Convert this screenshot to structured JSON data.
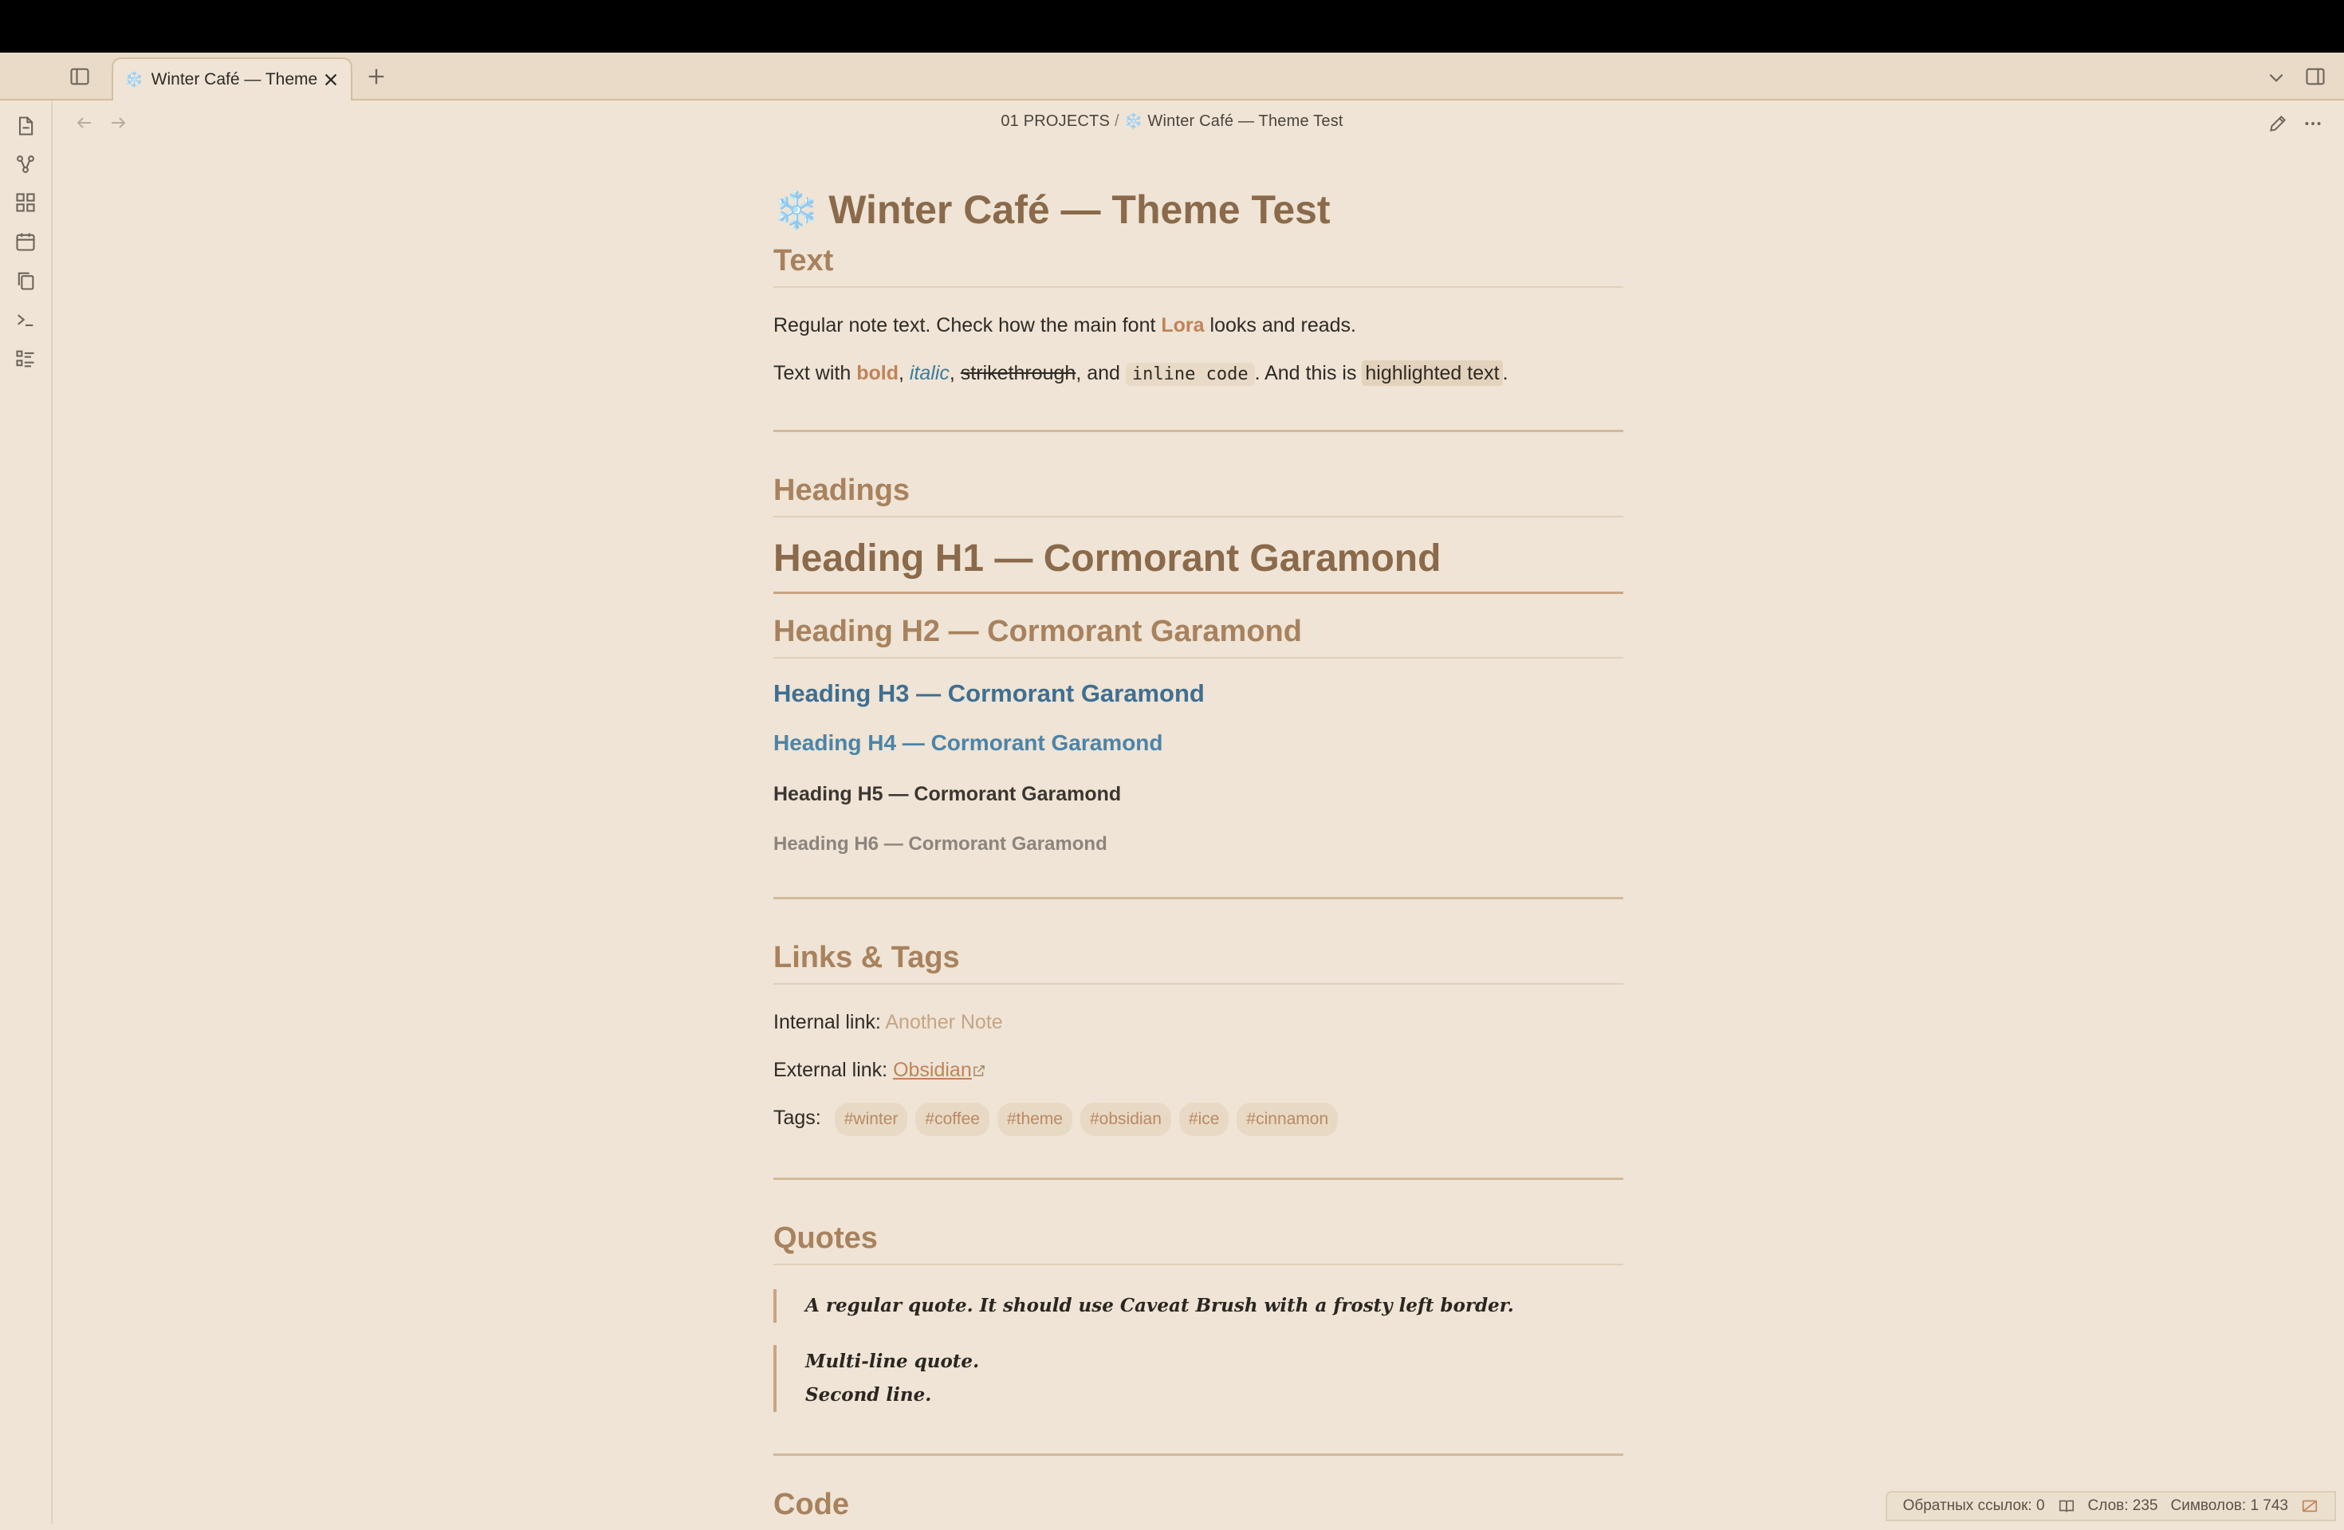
{
  "tab": {
    "title": "Winter Café — Theme ...",
    "emoji": "❄️"
  },
  "breadcrumb": {
    "folder": "01 PROJECTS",
    "separator": "/",
    "emoji": "❄️",
    "file": "Winter Café — Theme Test"
  },
  "note": {
    "title_emoji": "❄️",
    "title": "Winter Café — Theme Test",
    "text": {
      "heading": "Text",
      "p1_before": "Regular note text. Check how the main font ",
      "p1_font": "Lora",
      "p1_after": " looks and reads.",
      "p2_start": "Text with ",
      "bold": "bold",
      "comma1": ", ",
      "italic": "italic",
      "comma2": ", ",
      "strike": "strikethrough",
      "and": ", and ",
      "code": "inline code",
      "middle": ". And this is ",
      "highlight": "highlighted text",
      "end": "."
    },
    "headings": {
      "heading": "Headings",
      "h1": "Heading H1 — Cormorant Garamond",
      "h2": "Heading H2 — Cormorant Garamond",
      "h3": "Heading H3 — Cormorant Garamond",
      "h4": "Heading H4 — Cormorant Garamond",
      "h5": "Heading H5 — Cormorant Garamond",
      "h6": "Heading H6 — Cormorant Garamond"
    },
    "links": {
      "heading": "Links & Tags",
      "internal_label": "Internal link: ",
      "internal_link": "Another Note",
      "external_label": "External link: ",
      "external_link": "Obsidian",
      "tags_label": "Tags:",
      "tags": [
        "#winter",
        "#coffee",
        "#theme",
        "#obsidian",
        "#ice",
        "#cinnamon"
      ]
    },
    "quotes": {
      "heading": "Quotes",
      "q1": "A regular quote. It should use Caveat Brush with a frosty left border.",
      "q2_line1": "Multi-line quote.",
      "q2_line2": "Second line."
    },
    "code": {
      "heading": "Code"
    }
  },
  "status": {
    "backlinks": "Обратных ссылок: 0",
    "words": "Слов: 235",
    "chars": "Символов: 1 743"
  },
  "colors": {
    "background": "#efe4d5",
    "heading_brown": "#8a6a4a",
    "accent_orange": "#c0835a",
    "blue": "#3f6f92"
  }
}
